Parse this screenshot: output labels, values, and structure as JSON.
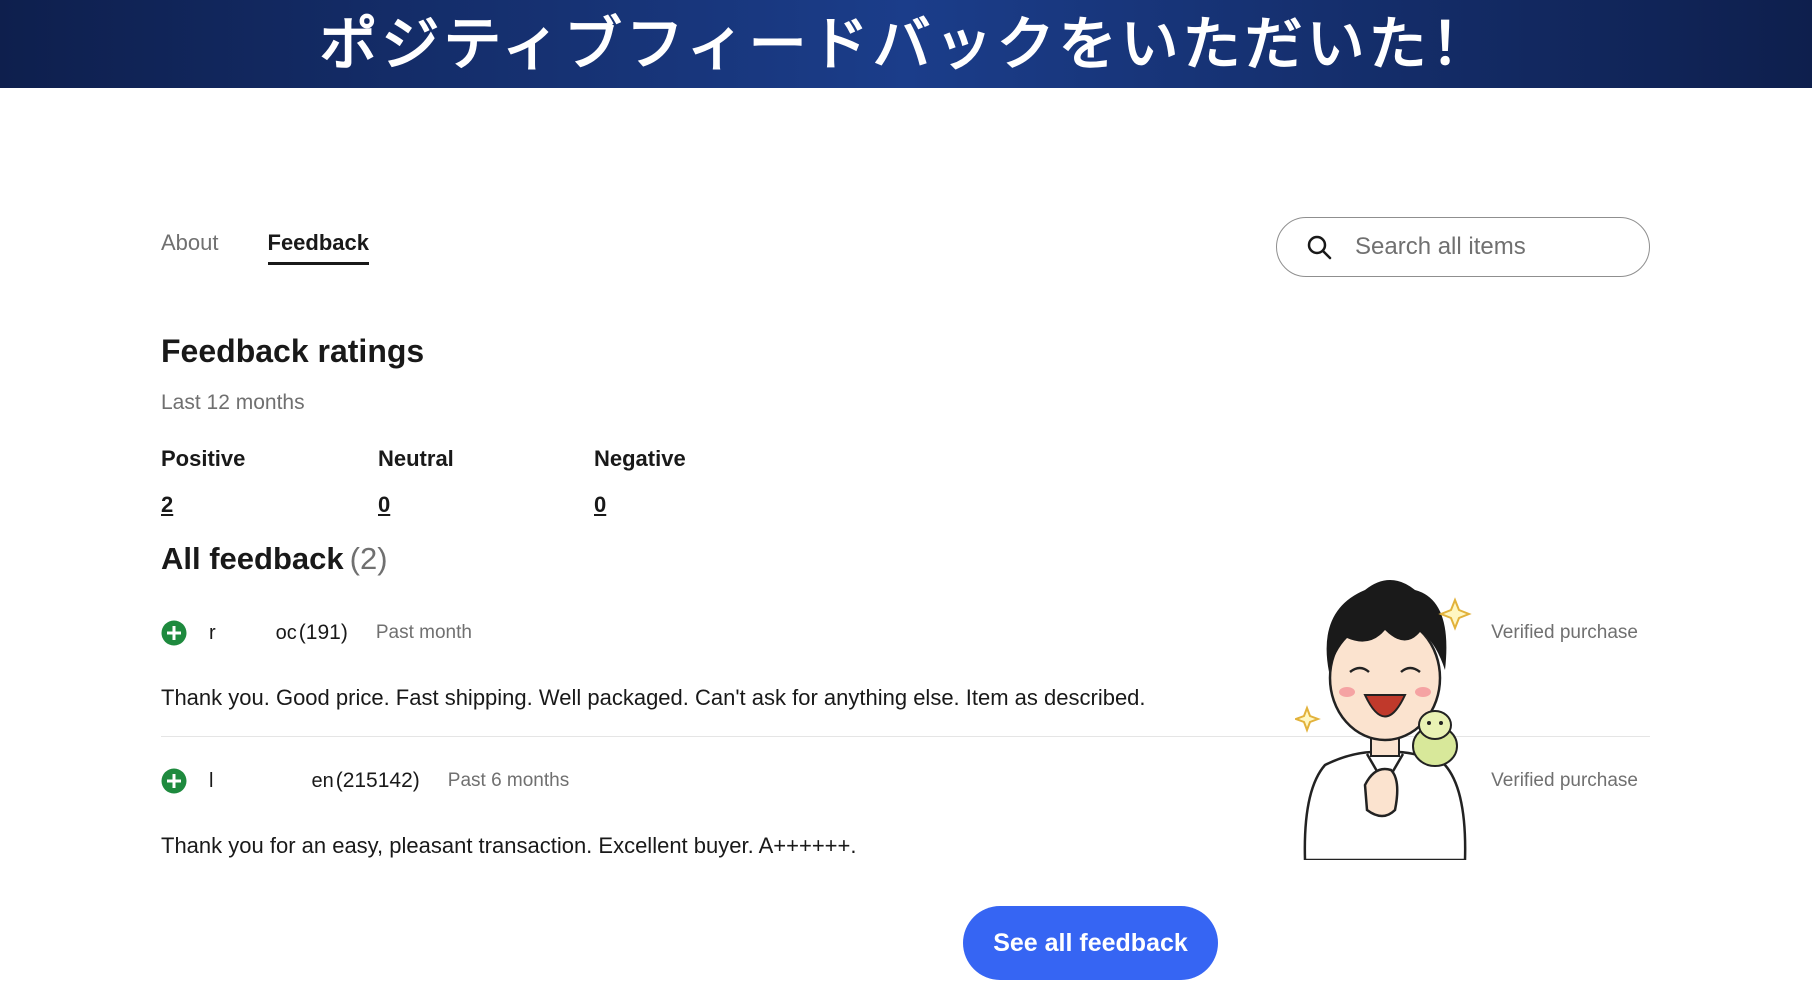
{
  "banner": {
    "title": "ポジティブフィードバックをいただいた！"
  },
  "tabs": [
    {
      "label": "About",
      "active": false
    },
    {
      "label": "Feedback",
      "active": true
    }
  ],
  "search": {
    "placeholder": "Search all items",
    "icon": "search-icon"
  },
  "ratings": {
    "title": "Feedback ratings",
    "period": "Last 12 months",
    "positive": {
      "label": "Positive",
      "count": "2"
    },
    "neutral": {
      "label": "Neutral",
      "count": "0"
    },
    "negative": {
      "label": "Negative",
      "count": "0"
    }
  },
  "all_feedback": {
    "title": "All feedback",
    "count": "(2)",
    "items": [
      {
        "user_prefix": "r",
        "user_suffix": "oc",
        "score": "(191)",
        "time": "Past month",
        "verified": "Verified purchase",
        "comment": "Thank you. Good price. Fast shipping. Well packaged. Can't ask for anything else. Item as described."
      },
      {
        "user_prefix": "l",
        "user_suffix": "en",
        "score": "(215142)",
        "time": "Past 6 months",
        "verified": "Verified purchase",
        "comment": "Thank you for an easy, pleasant transaction. Excellent buyer. A++++++."
      }
    ]
  },
  "cta": {
    "label": "See all feedback"
  },
  "colors": {
    "banner": "#1b3d8a",
    "positive_icon": "#1e8a3e",
    "cta": "#3665f3",
    "muted_text": "#707070"
  }
}
